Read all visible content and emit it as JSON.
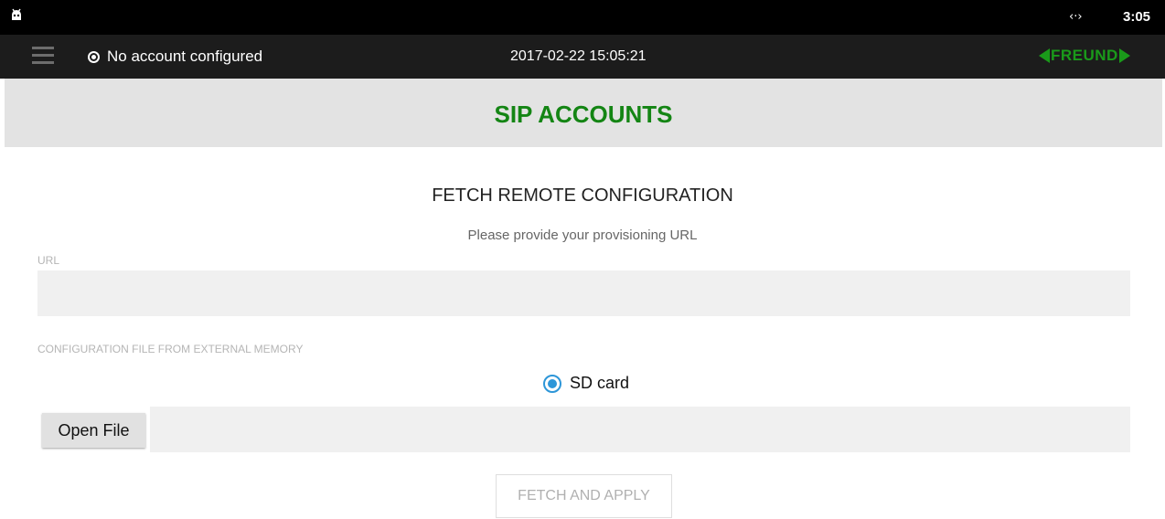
{
  "statusbar": {
    "network_icon": "code-arrows-icon",
    "time": "3:05"
  },
  "appbar": {
    "account_status": "No account configured",
    "datetime": "2017-02-22 15:05:21",
    "logo_text": "FREUND",
    "logo_color": "#1a9a1a"
  },
  "page": {
    "title": "SIP ACCOUNTS",
    "title_color": "#148514"
  },
  "form": {
    "section_title": "FETCH REMOTE CONFIGURATION",
    "subtitle": "Please provide your provisioning URL",
    "url_label": "URL",
    "url_value": "",
    "external_label": "CONFIGURATION FILE FROM EXTERNAL MEMORY",
    "source_option": "SD card",
    "source_selected": true,
    "open_file_label": "Open File",
    "file_path": "",
    "fetch_label": "FETCH AND APPLY"
  },
  "colors": {
    "radio_accent": "#2d96d8"
  }
}
